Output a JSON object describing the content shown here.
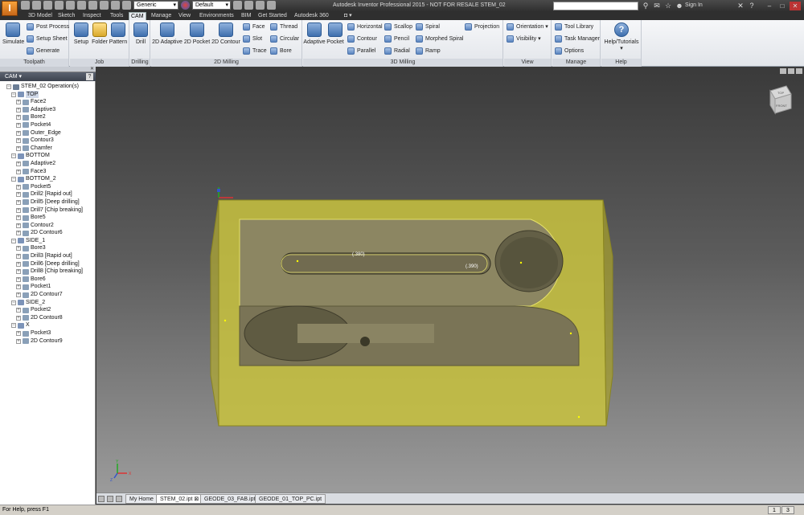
{
  "app": {
    "title": "Autodesk Inventor Professional 2015 - NOT FOR RESALE    STEM_02",
    "logo_letter": "I",
    "sign_in": "Sign In",
    "appearance_combo": "Generic",
    "material_combo": "Default"
  },
  "tabs": [
    "3D Model",
    "Sketch",
    "Inspect",
    "Tools",
    "CAM",
    "Manage",
    "View",
    "Environments",
    "BIM",
    "Get Started",
    "Autodesk 360"
  ],
  "active_tab": "CAM",
  "ribbon": {
    "toolpath": {
      "title": "Toolpath",
      "simulate": "Simulate",
      "post_process": "Post Process",
      "setup_sheet": "Setup Sheet",
      "generate": "Generate"
    },
    "job": {
      "title": "Job",
      "setup": "Setup",
      "folder": "Folder",
      "pattern": "Pattern"
    },
    "drilling": {
      "title": "Drilling",
      "drill": "Drill"
    },
    "milling2d": {
      "title": "2D Milling",
      "adaptive": "2D Adaptive",
      "pocket": "2D Pocket",
      "contour": "2D Contour",
      "face": "Face",
      "slot": "Slot",
      "trace": "Trace",
      "thread": "Thread",
      "circular": "Circular",
      "bore": "Bore"
    },
    "milling3d": {
      "title": "3D Milling",
      "adaptive": "Adaptive",
      "pocket": "Pocket",
      "horizontal": "Horizontal",
      "contour": "Contour",
      "parallel": "Parallel",
      "scallop": "Scallop",
      "pencil": "Pencil",
      "radial": "Radial",
      "spiral": "Spiral",
      "morphed_spiral": "Morphed Spiral",
      "ramp": "Ramp",
      "projection": "Projection"
    },
    "view": {
      "title": "View",
      "orientation": "Orientation",
      "visibility": "Visibility"
    },
    "manage": {
      "title": "Manage",
      "tool_library": "Tool Library",
      "task_manager": "Task Manager",
      "options": "Options"
    },
    "help": {
      "title": "Help",
      "help_tutorials": "Help/Tutorials"
    }
  },
  "browser": {
    "title": "CAM",
    "help_glyph": "?",
    "items": [
      {
        "label": "STEM_02 Operation(s)",
        "level": 0
      },
      {
        "label": "TOP",
        "level": 1
      },
      {
        "label": "Face2",
        "level": 2
      },
      {
        "label": "Adaptive3",
        "level": 2
      },
      {
        "label": "Bore2",
        "level": 2
      },
      {
        "label": "Pocket4",
        "level": 2
      },
      {
        "label": "Outer_Edge",
        "level": 2
      },
      {
        "label": "Contour3",
        "level": 2
      },
      {
        "label": "Chamfer",
        "level": 2
      },
      {
        "label": "BOTTOM",
        "level": 1
      },
      {
        "label": "Adaptive2",
        "level": 2
      },
      {
        "label": "Face3",
        "level": 2
      },
      {
        "label": "BOTTOM_2",
        "level": 1
      },
      {
        "label": "Pocket5",
        "level": 2
      },
      {
        "label": "Drill2 [Rapid out]",
        "level": 2
      },
      {
        "label": "Drill5 [Deep drilling]",
        "level": 2
      },
      {
        "label": "Drill7 [Chip breaking]",
        "level": 2
      },
      {
        "label": "Bore5",
        "level": 2
      },
      {
        "label": "Contour2",
        "level": 2
      },
      {
        "label": "2D Contour6",
        "level": 2
      },
      {
        "label": "SIDE_1",
        "level": 1
      },
      {
        "label": "Bore3",
        "level": 2
      },
      {
        "label": "Drill3 [Rapid out]",
        "level": 2
      },
      {
        "label": "Drill6 [Deep drilling]",
        "level": 2
      },
      {
        "label": "Drill8 [Chip breaking]",
        "level": 2
      },
      {
        "label": "Bore6",
        "level": 2
      },
      {
        "label": "Pocket1",
        "level": 2
      },
      {
        "label": "2D Contour7",
        "level": 2
      },
      {
        "label": "SIDE_2",
        "level": 1
      },
      {
        "label": "Pocket2",
        "level": 2
      },
      {
        "label": "2D Contour8",
        "level": 2
      },
      {
        "label": "X",
        "level": 1
      },
      {
        "label": "Pocket3",
        "level": 2
      },
      {
        "label": "2D Contour9",
        "level": 2
      }
    ]
  },
  "viewcube": {
    "top": "TOP",
    "front": "FRONT"
  },
  "viewport": {
    "dimension_1": "(.380)",
    "dimension_2": "(.390)",
    "axis_x": "X",
    "axis_y": "Y",
    "axis_z": "Z"
  },
  "doc_tabs": [
    "My Home",
    "STEM_02.ipt",
    "GEODE_03_FAB.ipt",
    "GEODE_01_TOP_PC.ipt"
  ],
  "active_doc": "STEM_02.ipt",
  "status": {
    "text": "For Help, press F1",
    "cell1": "1",
    "cell2": "3"
  },
  "colors": {
    "stock": "#c9c33e",
    "part": "#8c8662",
    "accent": "#3f6fae"
  }
}
